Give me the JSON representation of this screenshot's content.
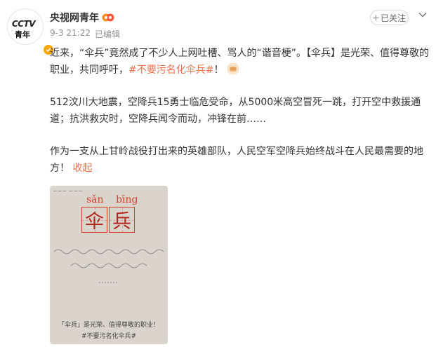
{
  "author": {
    "name": "央视网青年",
    "avatar_logo": "CCTV",
    "avatar_sub": "青年"
  },
  "meta": {
    "date": "9-3 21:22",
    "edited": "已编辑"
  },
  "follow_button": {
    "label": "已关注"
  },
  "post": {
    "p1_a": "近来，“伞兵”竟然成了不少人上网吐槽、骂人的“谐音梗”。【伞兵】是光荣、值得尊敬的职业，共同呼吁，",
    "p1_tag": "#不要污名化伞兵#",
    "p1_b": "！",
    "p2": "512汶川大地震，空降兵15勇士临危受命，从5000米高空冒死一跳，打开空中救援通道；抗洪救灾时，空降兵闻令而动，冲锋在前……",
    "p3": "作为一支从上甘岭战役打出来的英雄部队，人民空军空降兵始终战斗在人民最需要的地方！",
    "collapse": "收起"
  },
  "image": {
    "pinyin1": "sǎn",
    "pinyin2": "bīng",
    "char1": "伞",
    "char2": "兵",
    "bottom_line1": "「伞兵」是光荣、值得尊敬的职业！",
    "bottom_line2": "#不要污名化伞兵#"
  },
  "colors": {
    "link": "#eb7350",
    "verified": "#ffa800",
    "meta_gray": "#939393"
  },
  "icons": [
    "verified-badge-icon",
    "fan-badge-icon",
    "plus-icon",
    "chevron-down-icon",
    "fist-emoji-icon"
  ]
}
